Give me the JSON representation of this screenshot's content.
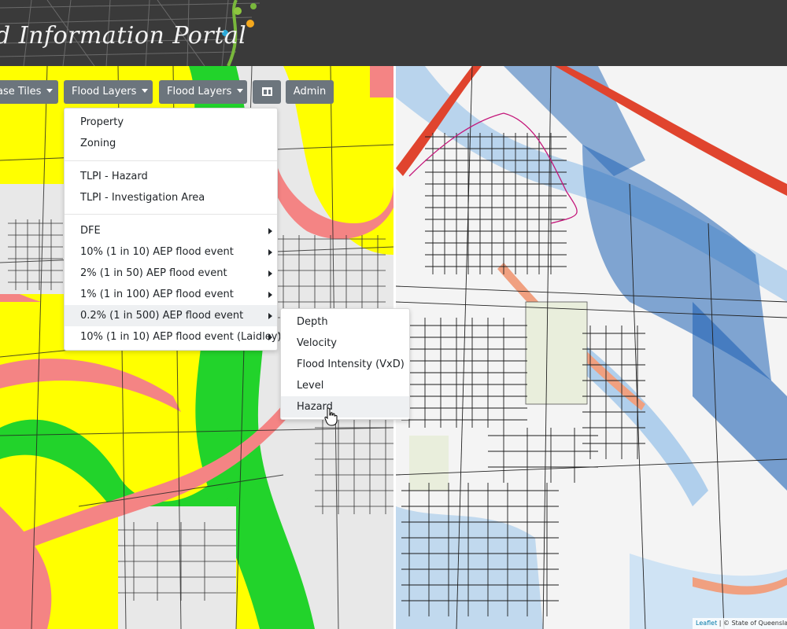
{
  "header": {
    "title": "d Information Portal"
  },
  "toolbar": {
    "base_tiles_label": "ase Tiles",
    "flood_layers_label_1": "Flood Layers",
    "flood_layers_label_2": "Flood Layers",
    "admin_label": "Admin"
  },
  "flood_menu": {
    "items": [
      "Property",
      "Zoning",
      "TLPI - Hazard",
      "TLPI - Investigation Area",
      "DFE",
      "10% (1 in 10) AEP flood event",
      "2% (1 in 50) AEP flood event",
      "1% (1 in 100) AEP flood event",
      "0.2% (1 in 500) AEP flood event",
      "10% (1 in 10) AEP flood event (Laidley)"
    ]
  },
  "sub_menu": {
    "items": [
      "Depth",
      "Velocity",
      "Flood Intensity (VxD)",
      "Level",
      "Hazard"
    ]
  },
  "attribution": {
    "leaflet": "Leaflet",
    "separator": " | © ",
    "credit": "State of Queensland"
  },
  "colors": {
    "header_bg": "#3a3a3a",
    "button_bg": "#6c757d",
    "hazard_yellow": "#ffff00",
    "hazard_green": "#22d32b",
    "hazard_pink": "#f48484",
    "depth_blue": "#1f63b4",
    "light_blue": "#9fc6ea"
  },
  "icons": {
    "split": "columns-icon",
    "cursor": "hand-pointer-icon"
  }
}
